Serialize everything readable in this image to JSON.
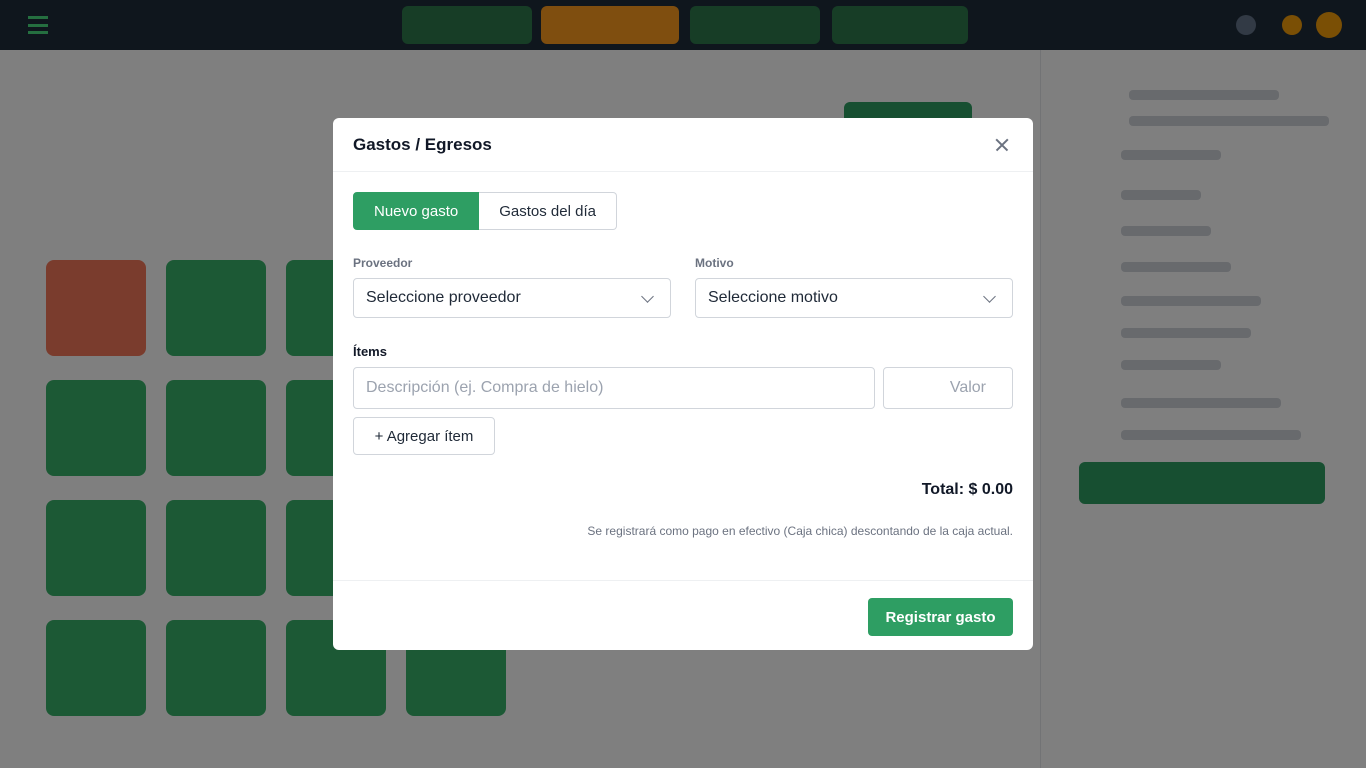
{
  "modal": {
    "title": "Gastos / Egresos",
    "tabs": [
      {
        "label": "Nuevo gasto",
        "active": true
      },
      {
        "label": "Gastos del día",
        "active": false
      }
    ],
    "proveedor": {
      "label": "Proveedor",
      "value": "Seleccione proveedor"
    },
    "motivo": {
      "label": "Motivo",
      "value": "Seleccione motivo"
    },
    "items_label": "Ítems",
    "description_placeholder": "Descripción (ej. Compra de hielo)",
    "value_placeholder": "Valor",
    "add_item_label": "+ Agregar ítem",
    "total": "Total: $ 0.00",
    "note": "Se registrará como pago en efectivo (Caja chica) descontando de la caja actual.",
    "submit_label": "Registrar gasto"
  },
  "colors": {
    "primary": "#2e9e63",
    "overlay": "rgba(0,0,0,0.5)",
    "accent_orange": "#ff9d1e",
    "topbar": "#1f2d3a"
  },
  "icons": [
    "menu-icon",
    "close-icon",
    "chevron-down-icon"
  ]
}
